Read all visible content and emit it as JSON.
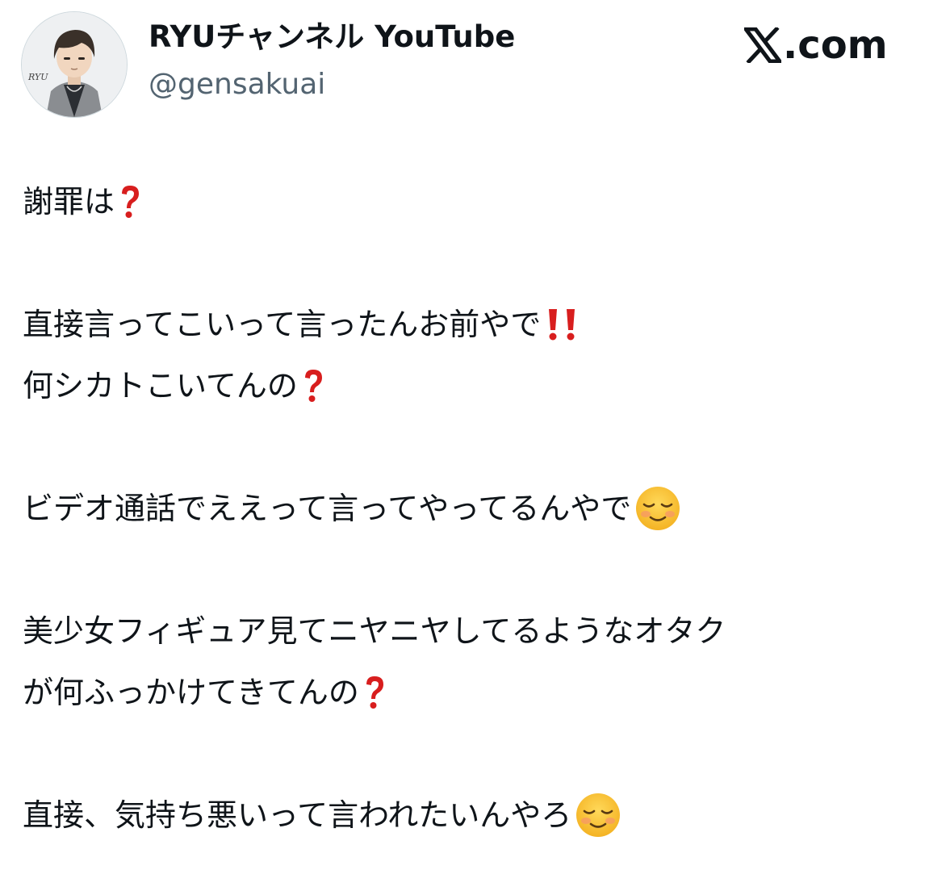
{
  "header": {
    "display_name": "RYUチャンネル YouTube",
    "handle": "@gensakuai",
    "brand": ".com",
    "brand_icon": "x-logo-icon",
    "avatar_text": "RYU"
  },
  "tweet": {
    "paragraphs": [
      {
        "lines": [
          {
            "text": "謝罪は",
            "emoji": "red-question-mark-icon"
          }
        ]
      },
      {
        "lines": [
          {
            "text": "直接言ってこいって言ったんお前やで",
            "emoji": "double-exclamation-icon"
          },
          {
            "text": "何シカトこいてんの",
            "emoji": "red-question-mark-icon"
          }
        ]
      },
      {
        "lines": [
          {
            "text": "ビデオ通話でええって言ってやってるんやで",
            "emoji": "smiling-face-icon"
          }
        ]
      },
      {
        "lines": [
          {
            "text": "美少女フィギュア見てニヤニヤしてるようなオタク",
            "emoji": ""
          },
          {
            "text": "が何ふっかけてきてんの",
            "emoji": "red-question-mark-icon"
          }
        ]
      },
      {
        "lines": [
          {
            "text": "直接、気持ち悪いって言われたいんやろ",
            "emoji": "smiling-face-icon"
          }
        ]
      }
    ]
  }
}
